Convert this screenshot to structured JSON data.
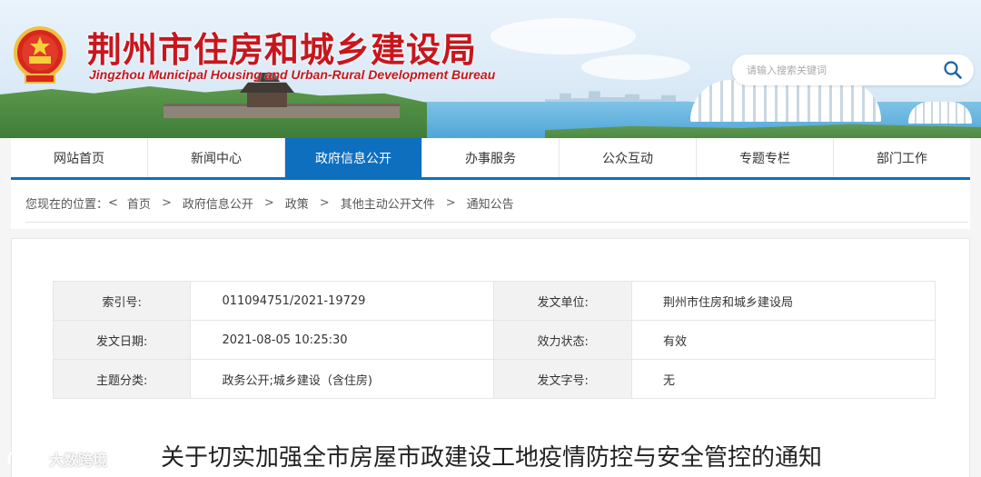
{
  "header": {
    "title": "荆州市住房和城乡建设局",
    "subtitle": "Jingzhou Municipal Housing and Urban-Rural Development Bureau"
  },
  "search": {
    "placeholder": "请输入搜索关键词",
    "icon": "search-icon"
  },
  "nav": {
    "items": [
      {
        "label": "网站首页"
      },
      {
        "label": "新闻中心"
      },
      {
        "label": "政府信息公开",
        "active": true
      },
      {
        "label": "办事服务"
      },
      {
        "label": "公众互动"
      },
      {
        "label": "专题专栏"
      },
      {
        "label": "部门工作"
      }
    ]
  },
  "breadcrumb": {
    "prefix": "您现在的位置：",
    "home_arrow": "<",
    "separator": ">",
    "items": [
      "首页",
      "政府信息公开",
      "政策",
      "其他主动公开文件",
      "通知公告"
    ]
  },
  "meta": {
    "rows": [
      {
        "k1": "索引号:",
        "v1": "011094751/2021-19729",
        "k2": "发文单位:",
        "v2": "荆州市住房和城乡建设局"
      },
      {
        "k1": "发文日期:",
        "v1": "2021-08-05 10:25:30",
        "k2": "效力状态:",
        "v2": "有效"
      },
      {
        "k1": "主题分类:",
        "v1": "政务公开;城乡建设（含住房)",
        "k2": "发文字号:",
        "v2": "无"
      }
    ]
  },
  "document": {
    "title": "关于切实加强全市房屋市政建设工地疫情防控与安全管控的通知"
  },
  "watermark": {
    "text": "大数跨境"
  },
  "colors": {
    "brand_red": "#c8161d",
    "nav_blue": "#0f6fbf"
  }
}
